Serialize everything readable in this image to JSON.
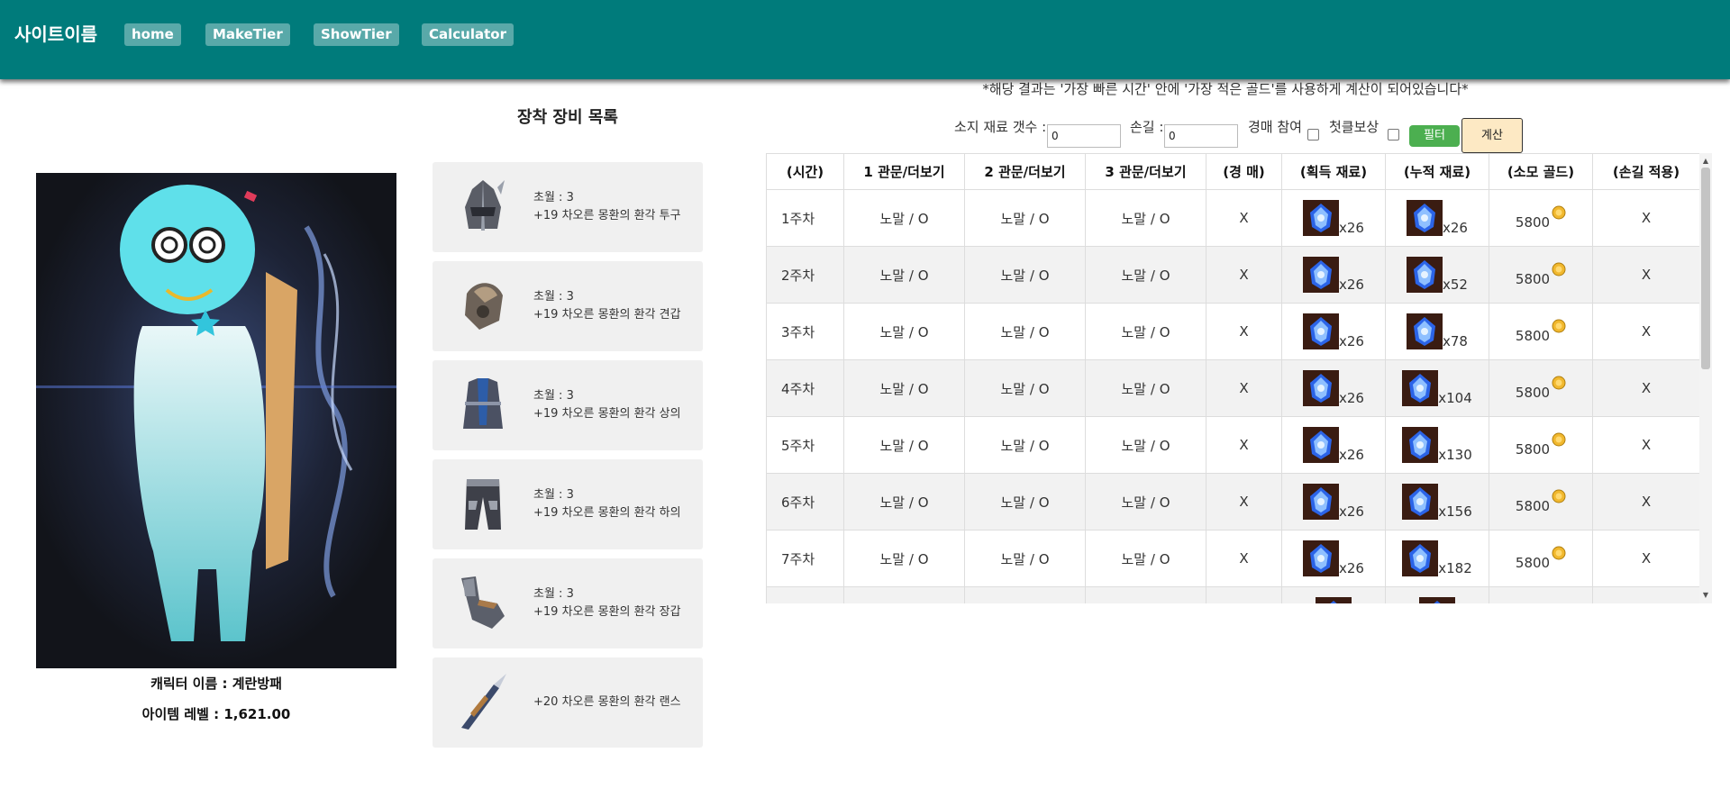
{
  "nav": {
    "brand": "사이트이름",
    "items": [
      "home",
      "MakeTier",
      "ShowTier",
      "Calculator"
    ]
  },
  "character": {
    "name_label": "캐릭터 이름 : 계란방패",
    "level_label": "아이템 레벨 : 1,621.00"
  },
  "equipment": {
    "title": "장착 장비 목록",
    "items": [
      {
        "transcend": "초월 : 3",
        "name": "+19 차오른 몽환의 환각 투구",
        "icon": "helmet-icon"
      },
      {
        "transcend": "초월 : 3",
        "name": "+19 차오른 몽환의 환각 견갑",
        "icon": "shoulder-icon"
      },
      {
        "transcend": "초월 : 3",
        "name": "+19 차오른 몽환의 환각 상의",
        "icon": "chest-armor-icon"
      },
      {
        "transcend": "초월 : 3",
        "name": "+19 차오른 몽환의 환각 하의",
        "icon": "pants-icon"
      },
      {
        "transcend": "초월 : 3",
        "name": "+19 차오른 몽환의 환각 장갑",
        "icon": "gloves-icon"
      },
      {
        "transcend": "",
        "name": "+20 차오른 몽환의 환각 랜스",
        "icon": "lance-icon"
      }
    ]
  },
  "calculator": {
    "notice": "*해당 결과는 '가장 빠른 시간' 안에 '가장 적은 골드'를 사용하게 계산이 되어있습니다*",
    "owned_label": "소지 재료 갯수 :",
    "owned_value": "0",
    "hand_label": "손길 :",
    "hand_value": "0",
    "auction_label": "경매 참여",
    "first_clear_label": "첫클보상",
    "filter_label": "필터",
    "calc_label": "계산"
  },
  "table": {
    "headers": [
      "(시간)",
      "1 관문/더보기",
      "2 관문/더보기",
      "3 관문/더보기",
      "(경 매)",
      "(획득 재료)",
      "(누적 재료)",
      "(소모 골드)",
      "(손길 적용)"
    ],
    "rows": [
      {
        "time": "1주차",
        "g1": "노말 / O",
        "g2": "노말 / O",
        "g3": "노말 / O",
        "auction": "X",
        "gain": "x26",
        "total": "x26",
        "gold": "5800",
        "hand": "X"
      },
      {
        "time": "2주차",
        "g1": "노말 / O",
        "g2": "노말 / O",
        "g3": "노말 / O",
        "auction": "X",
        "gain": "x26",
        "total": "x52",
        "gold": "5800",
        "hand": "X"
      },
      {
        "time": "3주차",
        "g1": "노말 / O",
        "g2": "노말 / O",
        "g3": "노말 / O",
        "auction": "X",
        "gain": "x26",
        "total": "x78",
        "gold": "5800",
        "hand": "X"
      },
      {
        "time": "4주차",
        "g1": "노말 / O",
        "g2": "노말 / O",
        "g3": "노말 / O",
        "auction": "X",
        "gain": "x26",
        "total": "x104",
        "gold": "5800",
        "hand": "X"
      },
      {
        "time": "5주차",
        "g1": "노말 / O",
        "g2": "노말 / O",
        "g3": "노말 / O",
        "auction": "X",
        "gain": "x26",
        "total": "x130",
        "gold": "5800",
        "hand": "X"
      },
      {
        "time": "6주차",
        "g1": "노말 / O",
        "g2": "노말 / O",
        "g3": "노말 / O",
        "auction": "X",
        "gain": "x26",
        "total": "x156",
        "gold": "5800",
        "hand": "X"
      },
      {
        "time": "7주차",
        "g1": "노말 / O",
        "g2": "노말 / O",
        "g3": "노말 / O",
        "auction": "X",
        "gain": "x26",
        "total": "x182",
        "gold": "5800",
        "hand": "X"
      }
    ]
  }
}
